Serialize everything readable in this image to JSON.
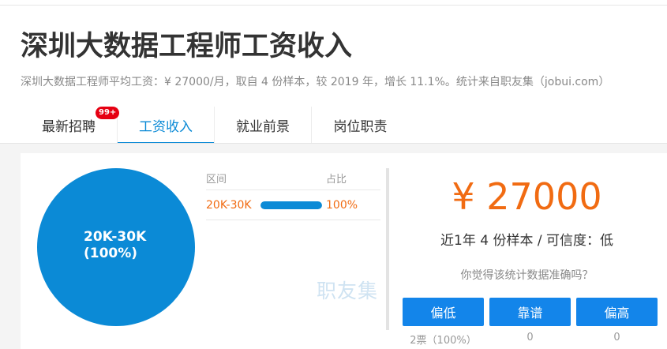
{
  "page": {
    "title": "深圳大数据工程师工资收入",
    "subtitle": "深圳大数据工程师平均工资：¥ 27000/月，取自 4 份样本，较 2019 年，增长 11.1%。统计来自职友集（jobui.com）"
  },
  "tabs": [
    {
      "label": "最新招聘",
      "badge": "99+",
      "active": false
    },
    {
      "label": "工资收入",
      "active": true
    },
    {
      "label": "就业前景",
      "active": false
    },
    {
      "label": "岗位职责",
      "active": false
    }
  ],
  "pie": {
    "label_range": "20K-30K",
    "label_pct": "(100%)",
    "color": "#0b8ad6"
  },
  "distribution": {
    "header_range": "区间",
    "header_pct": "占比",
    "rows": [
      {
        "range": "20K-30K",
        "fraction": 1.0,
        "pct": "100%"
      }
    ]
  },
  "watermark": "职友集",
  "summary": {
    "avg_salary": "¥ 27000",
    "sample_info": "近1年 4 份样本 / 可信度：低",
    "question": "你觉得该统计数据准确吗？"
  },
  "votes": [
    {
      "label": "偏低",
      "count": "2票（100%）"
    },
    {
      "label": "靠谱",
      "count": "0"
    },
    {
      "label": "偏高",
      "count": "0"
    }
  ],
  "colors": {
    "accent": "#0b8ad6",
    "salary": "#f16b12",
    "button": "#1385ea",
    "badge": "#e60012"
  }
}
